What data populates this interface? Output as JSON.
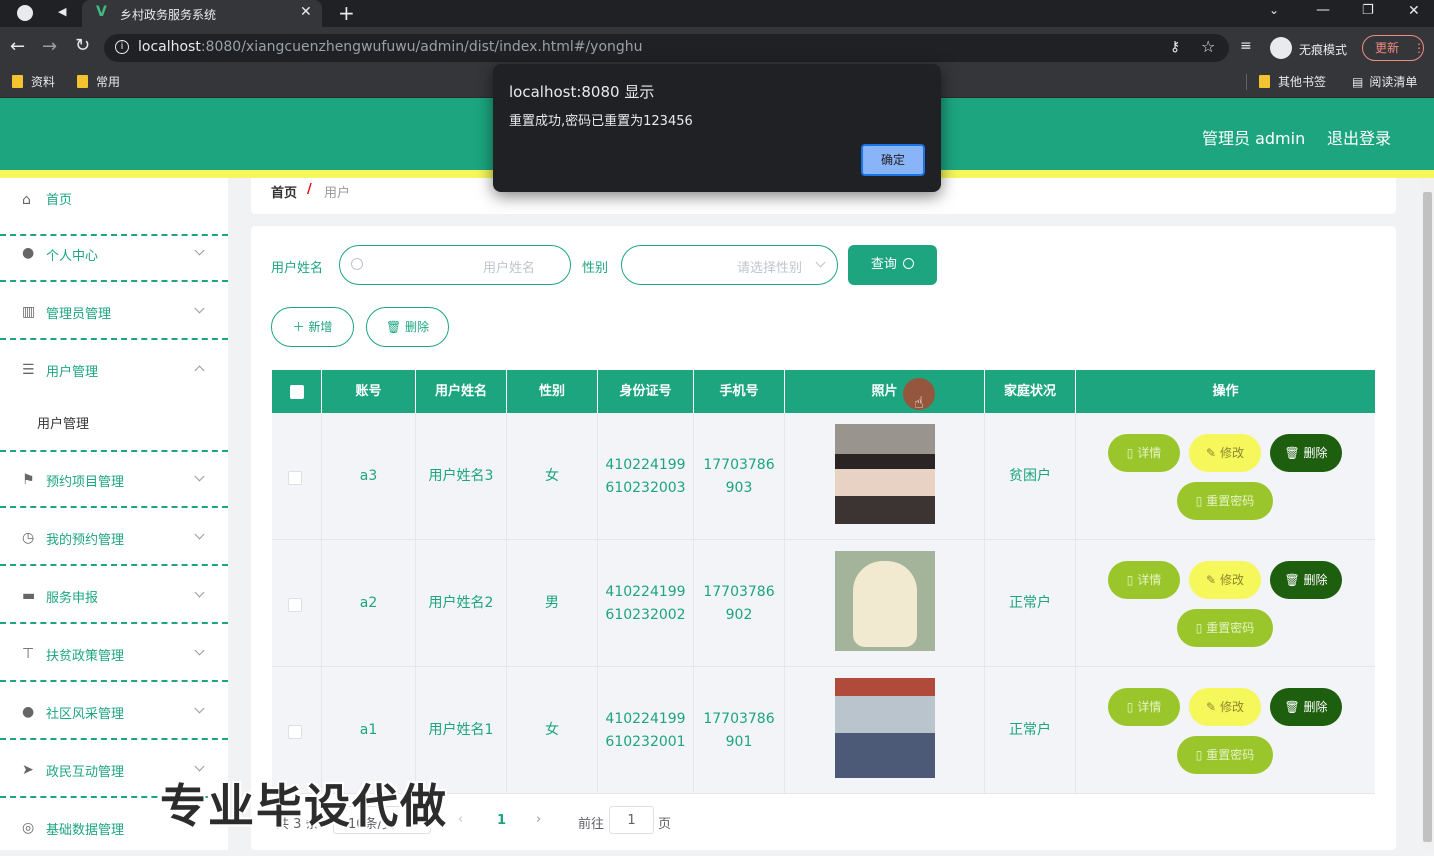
{
  "browser": {
    "tab_title": "乡村政务服务系统",
    "url_host": "localhost",
    "url_rest": ":8080/xiangcuenzhengwufuwu/admin/dist/index.html#/yonghu",
    "incognito_label": "无痕模式",
    "update_label": "更新",
    "bookmarks": [
      "资料",
      "常用"
    ],
    "bookmarks_right": [
      "其他书签",
      "阅读清单"
    ]
  },
  "header": {
    "admin_label": "管理员 admin",
    "logout_label": "退出登录"
  },
  "sidebar": {
    "items": [
      {
        "label": "首页",
        "icon": "home-icon"
      },
      {
        "label": "个人中心",
        "icon": "user-icon"
      },
      {
        "label": "管理员管理",
        "icon": "books-icon"
      },
      {
        "label": "用户管理",
        "icon": "list-icon",
        "expanded": true
      },
      {
        "label": "预约项目管理",
        "icon": "flag-icon"
      },
      {
        "label": "我的预约管理",
        "icon": "clock-icon"
      },
      {
        "label": "服务申报",
        "icon": "chat-icon"
      },
      {
        "label": "扶贫政策管理",
        "icon": "sign-icon"
      },
      {
        "label": "社区风采管理",
        "icon": "location-icon"
      },
      {
        "label": "政民互动管理",
        "icon": "send-icon"
      },
      {
        "label": "基础数据管理",
        "icon": "basketball-icon"
      }
    ],
    "sub_item": "用户管理"
  },
  "breadcrumb": {
    "home": "首页",
    "separator": "/",
    "current": "用户"
  },
  "search": {
    "name_label": "用户姓名",
    "name_placeholder": "用户姓名",
    "gender_label": "性别",
    "gender_placeholder": "请选择性别",
    "query_label": "查询"
  },
  "actions": {
    "add_label": "新增",
    "delete_label": "删除"
  },
  "table": {
    "headers": [
      "账号",
      "用户姓名",
      "性别",
      "身份证号",
      "手机号",
      "照片",
      "家庭状况",
      "操作"
    ],
    "rows": [
      {
        "account": "a3",
        "name": "用户姓名3",
        "gender": "女",
        "id_1": "410224199",
        "id_2": "610232003",
        "phone_1": "17703786",
        "phone_2": "903",
        "status": "贫困户"
      },
      {
        "account": "a2",
        "name": "用户姓名2",
        "gender": "男",
        "id_1": "410224199",
        "id_2": "610232002",
        "phone_1": "17703786",
        "phone_2": "902",
        "status": "正常户"
      },
      {
        "account": "a1",
        "name": "用户姓名1",
        "gender": "女",
        "id_1": "410224199",
        "id_2": "610232001",
        "phone_1": "17703786",
        "phone_2": "901",
        "status": "正常户"
      }
    ],
    "op_labels": {
      "detail": "详情",
      "edit": "修改",
      "delete": "删除",
      "reset": "重置密码"
    }
  },
  "pagination": {
    "total": "共 3 条",
    "page_size": "10条/页",
    "current_page": "1",
    "goto_label": "前往",
    "goto_value": "1",
    "page_unit": "页"
  },
  "dialog": {
    "title": "localhost:8080 显示",
    "message": "重置成功,密码已重置为123456",
    "ok_label": "确定"
  },
  "watermark": "专业毕设代做",
  "colors": {
    "brand": "#1ca57f",
    "accent_yellow": "#f5f75a",
    "detail": "#9ac62b",
    "delete": "#1d5e0f"
  }
}
